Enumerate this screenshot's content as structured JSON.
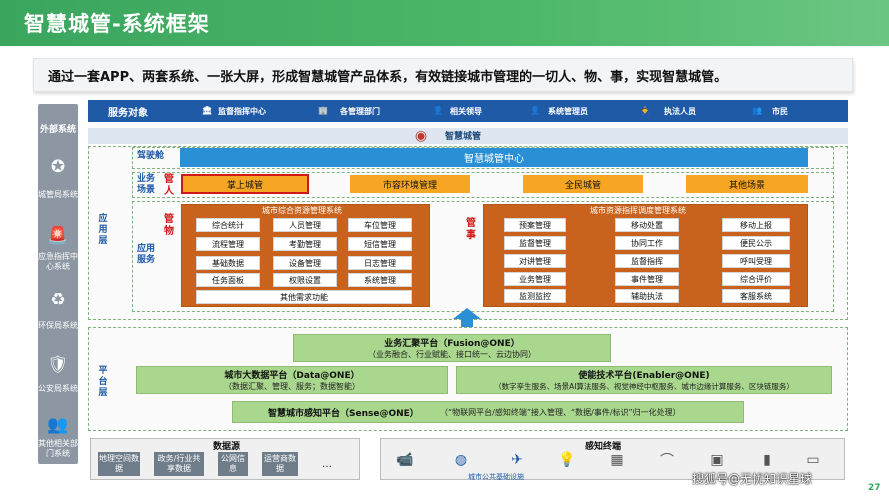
{
  "title": "智慧城管-系统框架",
  "subtitle": "通过一套APP、两套系统、一张大屏，形成智慧城管产品体系，有效链接城市管理的一切人、物、事，实现智慧城管。",
  "sidebar": {
    "header": "外部系统",
    "items": [
      {
        "label": "城管局系统",
        "icon": "badge-icon"
      },
      {
        "label": "应急指挥中心系统",
        "icon": "alarm-icon"
      },
      {
        "label": "环保局系统",
        "icon": "recycle-icon"
      },
      {
        "label": "公安局系统",
        "icon": "police-badge-icon"
      },
      {
        "label": "其他相关部门系统",
        "icon": "people-icon"
      }
    ]
  },
  "service_bar": {
    "label": "服务对象",
    "items": [
      "监督指挥中心",
      "各管理部门",
      "相关领导",
      "系统管理员",
      "执法人员",
      "市民"
    ]
  },
  "platform_title": "智慧城管",
  "application_layer": {
    "label": "应用层",
    "cockpit_label": "驾驶舱",
    "cockpit_title": "智慧城管中心",
    "business_label": "业务场景",
    "guan_ren": "管人",
    "scenes": [
      "掌上城管",
      "市容环境管理",
      "全民城管",
      "其他场景"
    ],
    "services_label": "应用服务",
    "guan_wu": "管物",
    "guan_shi": "管事",
    "resource_panel": {
      "title": "城市综合资源管理系统",
      "cells": [
        "综合统计",
        "人员管理",
        "车位管理",
        "流程管理",
        "考勤管理",
        "短信管理",
        "基础数据",
        "设备管理",
        "日志管理",
        "任务面板",
        "权限设置",
        "系统管理"
      ],
      "footer": "其他需求功能"
    },
    "dispatch_panel": {
      "title": "城市资源指挥调度管理系统",
      "cells": [
        "预案管理",
        "移动处置",
        "监督管理",
        "协同工作",
        "对讲管理",
        "监督指挥",
        "业务管理",
        "事件管理",
        "监测监控",
        "辅助执法"
      ],
      "right_cells": [
        "移动上报",
        "便民公示",
        "呼叫受理",
        "综合评价",
        "客服系统"
      ]
    }
  },
  "platform_layer": {
    "label": "平台层",
    "fusion": {
      "title": "业务汇聚平台（Fusion@ONE）",
      "desc": "（业务融合、行业赋能、接口统一、云边协同）"
    },
    "data": {
      "title": "城市大数据平台（Data@ONE）",
      "desc": "（数据汇聚、管理、服务；数据智能）"
    },
    "enabler": {
      "title": "使能技术平台(Enabler@ONE)",
      "desc": "（数字孪生服务、场景AI算法服务、视觉神经中枢服务、城市边缘计算服务、区块链服务）"
    },
    "sense": {
      "title": "智慧城市感知平台（Sense@ONE）",
      "desc": "（“物联网平台/感知终端”接入管理、“数据/事件/标识”归一化处理）"
    }
  },
  "data_sources": {
    "label": "数据源",
    "items": [
      "地理空间数据",
      "政务/行业共享数据",
      "公网信息",
      "运营商数据",
      "…"
    ]
  },
  "sensing": {
    "label": "感知终端",
    "caption": "城市公共基础设施"
  },
  "watermark": "搜狐号@无忧知识星球",
  "page_number": "27"
}
